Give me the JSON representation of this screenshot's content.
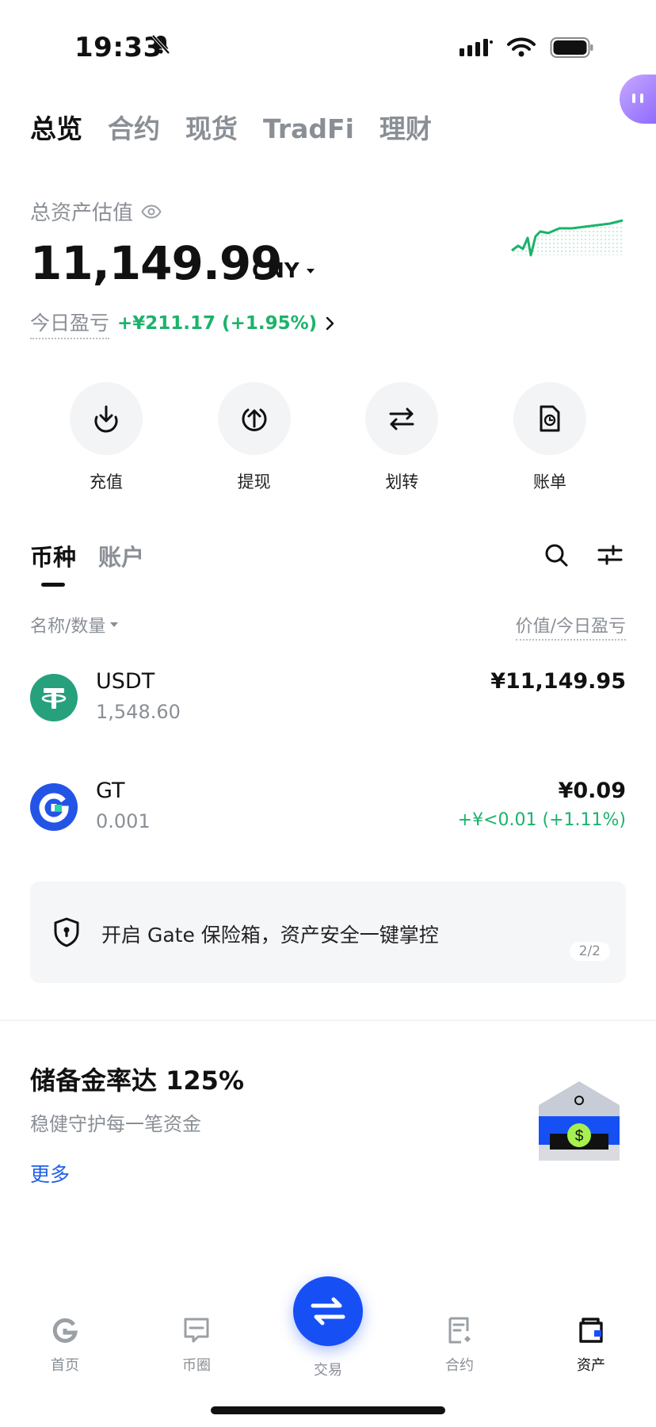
{
  "status_bar": {
    "time": "19:33"
  },
  "top_tabs": [
    "总览",
    "合约",
    "现货",
    "TradFi",
    "理财"
  ],
  "asset": {
    "label": "总资产估值",
    "value": "11,149.99",
    "unit": "CNY",
    "pnl_label": "今日盈亏",
    "pnl_value": "+¥211.17 (+1.95%)"
  },
  "actions": [
    "充值",
    "提现",
    "划转",
    "账单"
  ],
  "list": {
    "tabs": [
      "币种",
      "账户"
    ],
    "col_left": "名称/数量",
    "col_right": "价值/今日盈亏",
    "coins": [
      {
        "name": "USDT",
        "amount": "1,548.60",
        "value": "¥11,149.95",
        "change": ""
      },
      {
        "name": "GT",
        "amount": "0.001",
        "value": "¥0.09",
        "change": "+¥<0.01 (+1.11%)"
      }
    ]
  },
  "banner": {
    "text": "开启 Gate 保险箱，资产安全一键掌控",
    "page": "2/2"
  },
  "reserve": {
    "title": "储备金率达 125%",
    "subtitle": "稳健守护每一笔资金",
    "more": "更多"
  },
  "bottom_nav": [
    "首页",
    "币圈",
    "交易",
    "合约",
    "资产"
  ],
  "colors": {
    "green": "#1bb36b",
    "blue": "#1650f5",
    "link": "#1f5fe8"
  }
}
